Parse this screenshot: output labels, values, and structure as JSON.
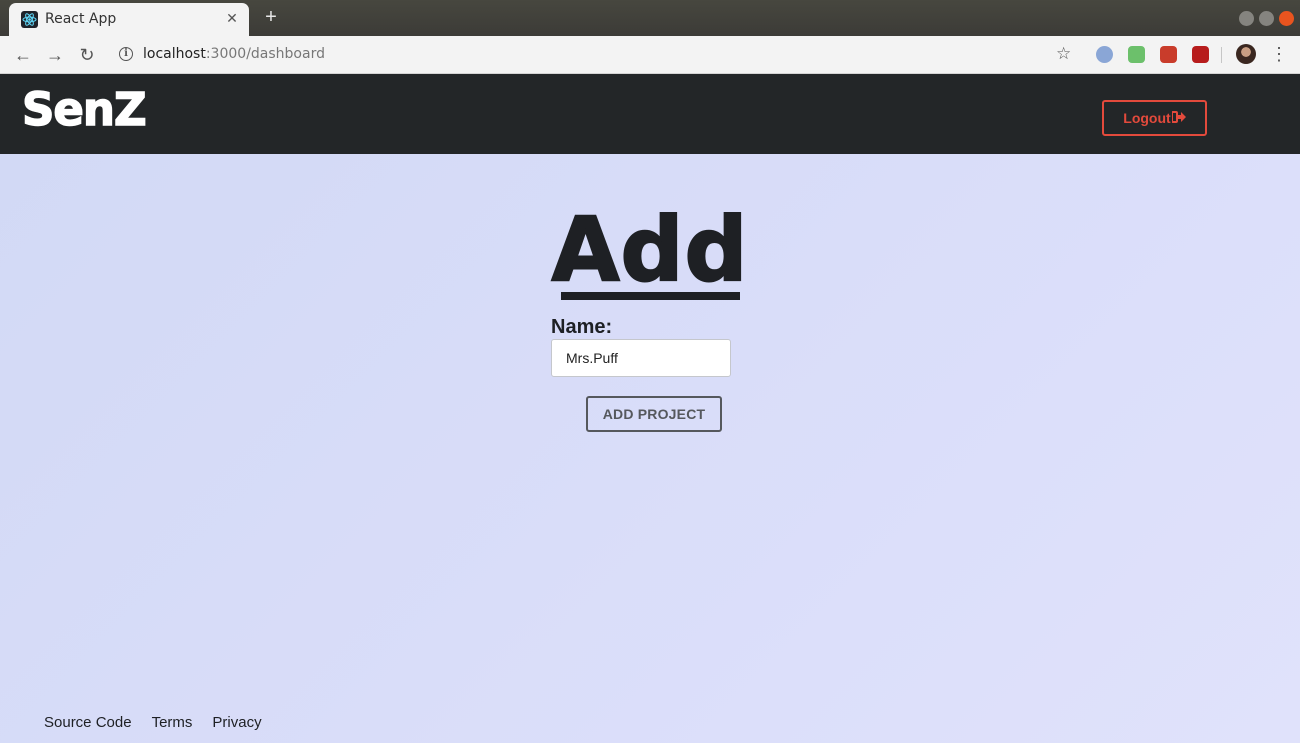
{
  "browser": {
    "tab_title": "React App",
    "tab_close": "✕",
    "new_tab": "+",
    "url_host": "localhost",
    "url_path": ":3000/dashboard"
  },
  "app": {
    "brand": "SenZ",
    "logout_label": "Logout",
    "logout_icon": "sign-out-icon",
    "accent_color": "#e34a3c"
  },
  "form": {
    "title": "Add",
    "name_label": "Name:",
    "name_value": "Mrs.Puff",
    "submit_label": "ADD PROJECT"
  },
  "footer": {
    "links": [
      "Source Code",
      "Terms",
      "Privacy"
    ]
  }
}
